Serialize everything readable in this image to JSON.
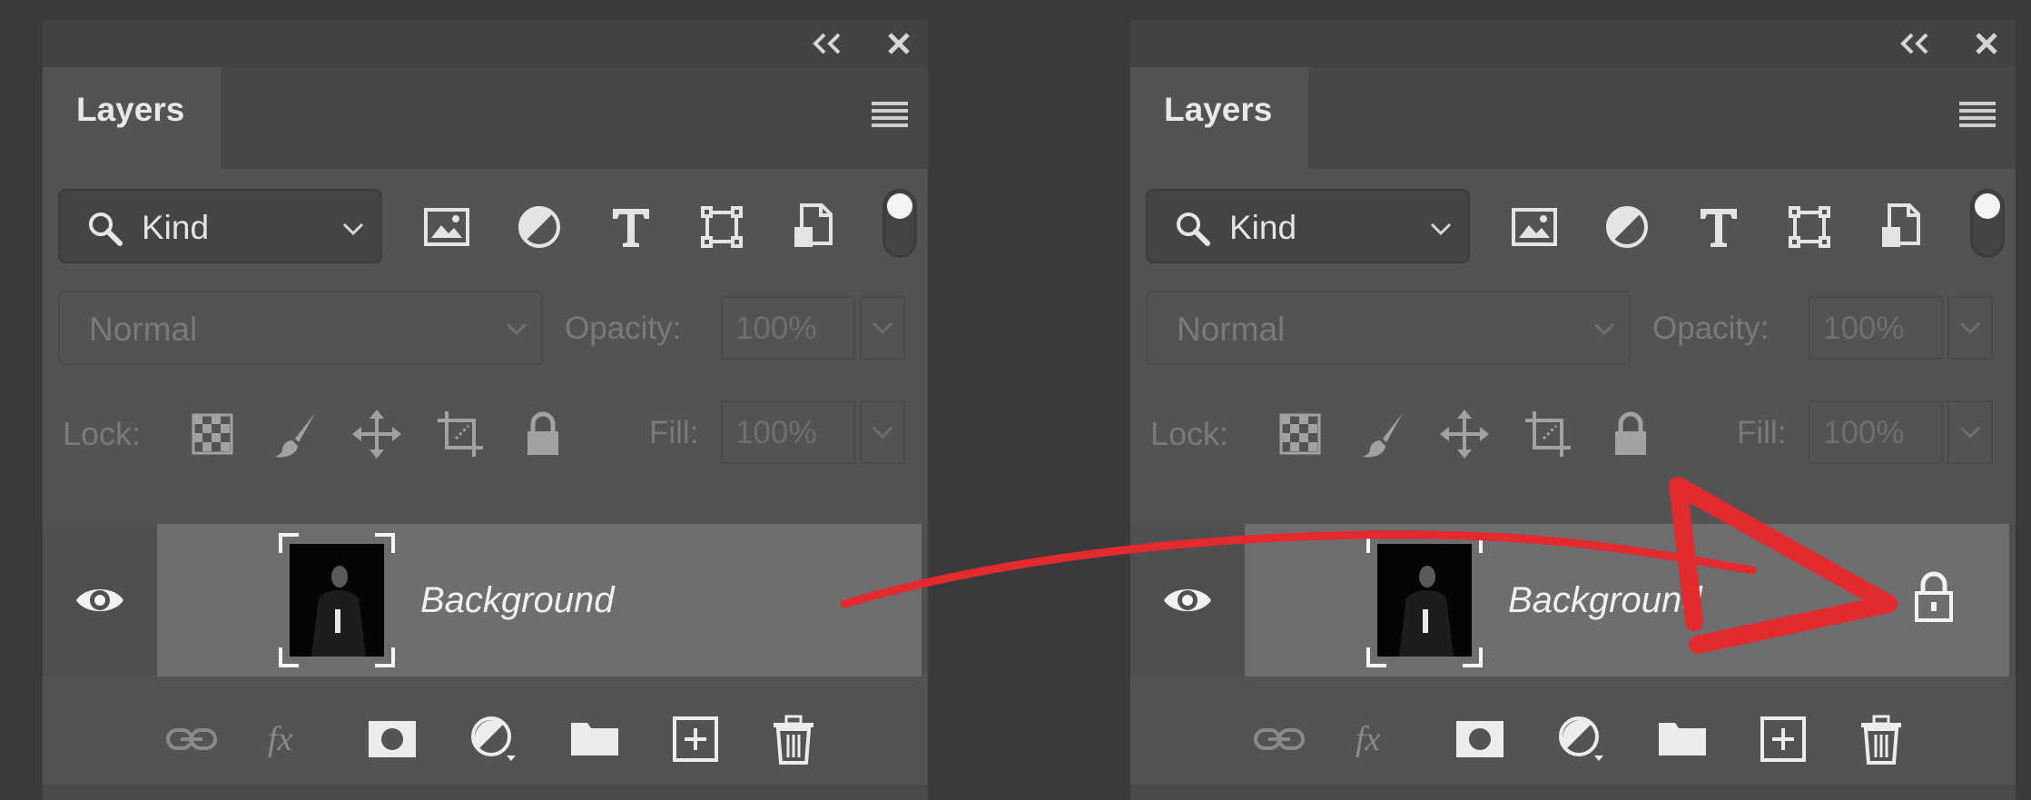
{
  "panels": [
    {
      "tab_label": "Layers",
      "filter": {
        "kind_label": "Kind"
      },
      "blend_mode": "Normal",
      "opacity_label": "Opacity:",
      "opacity_value": "100%",
      "lock_label": "Lock:",
      "fill_label": "Fill:",
      "fill_value": "100%",
      "layer": {
        "name": "Background",
        "locked_indicator_visible": false
      }
    },
    {
      "tab_label": "Layers",
      "filter": {
        "kind_label": "Kind"
      },
      "blend_mode": "Normal",
      "opacity_label": "Opacity:",
      "opacity_value": "100%",
      "lock_label": "Lock:",
      "fill_label": "Fill:",
      "fill_value": "100%",
      "layer": {
        "name": "Background",
        "locked_indicator_visible": true
      }
    }
  ],
  "icons": {
    "titlebar": [
      "collapse-icon",
      "close-icon"
    ],
    "filter": [
      "pixel-layer-filter-icon",
      "adjustment-layer-filter-icon",
      "type-layer-filter-icon",
      "shape-layer-filter-icon",
      "smart-object-filter-icon"
    ],
    "lock": [
      "lock-transparent-pixels-icon",
      "lock-image-pixels-icon",
      "lock-position-icon",
      "lock-artboard-icon",
      "lock-all-icon"
    ],
    "bottom": [
      "link-layers-icon",
      "layer-style-icon",
      "add-mask-icon",
      "new-adjustment-layer-icon",
      "new-group-icon",
      "new-layer-icon",
      "delete-layer-icon"
    ]
  },
  "annotation": {
    "arrow_color": "#e32a2e"
  },
  "colors": {
    "app_background": "#3a3a3a",
    "panel": "#535353",
    "selected_layer": "#6e6e6e"
  }
}
